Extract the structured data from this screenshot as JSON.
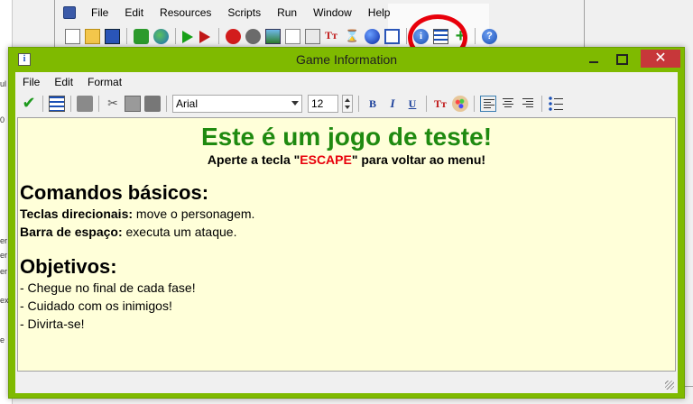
{
  "background_ide": {
    "menu": [
      "File",
      "Edit",
      "Resources",
      "Scripts",
      "Run",
      "Window",
      "Help"
    ],
    "toolbar_icons": [
      "new-file-icon",
      "open-file-icon",
      "save-icon",
      "create-executable-icon",
      "publish-globe-icon",
      "run-icon",
      "run-debug-icon",
      "sprite-icon",
      "sound-icon",
      "background-icon",
      "path-icon",
      "script-icon",
      "font-icon",
      "timeline-icon",
      "object-icon",
      "room-icon",
      "game-information-icon",
      "global-settings-icon",
      "extension-packages-icon",
      "help-icon"
    ],
    "left_strip_fragments": [
      "ul",
      "0",
      "er",
      "er",
      "er",
      "ex",
      "e"
    ],
    "highlight_color": "#e8000b"
  },
  "window": {
    "title": "Game Information",
    "accent_color": "#7fba00",
    "close_glyph": "✕",
    "icon_glyph": "i"
  },
  "menu": [
    "File",
    "Edit",
    "Format"
  ],
  "toolbar": {
    "font_name": "Arial",
    "font_size": "12",
    "active_alignment": "align-left"
  },
  "content": {
    "heading": "Este é um jogo de teste!",
    "subtitle_pre": "Aperte a tecla \"",
    "subtitle_key": "ESCAPE",
    "subtitle_post": "\" para voltar ao menu!",
    "section1_title": "Comandos básicos:",
    "line1_label": "Teclas direcionais:",
    "line1_text": " move o personagem.",
    "line2_label": "Barra de espaço:",
    "line2_text": " executa um ataque.",
    "section2_title": "Objetivos:",
    "goals": [
      "- Chegue no final de cada fase!",
      "- Cuidado com os inimigos!",
      "- Divirta-se!"
    ],
    "heading_color": "#1f8a10",
    "key_color": "#e8000b",
    "background_color": "#ffffd9"
  }
}
